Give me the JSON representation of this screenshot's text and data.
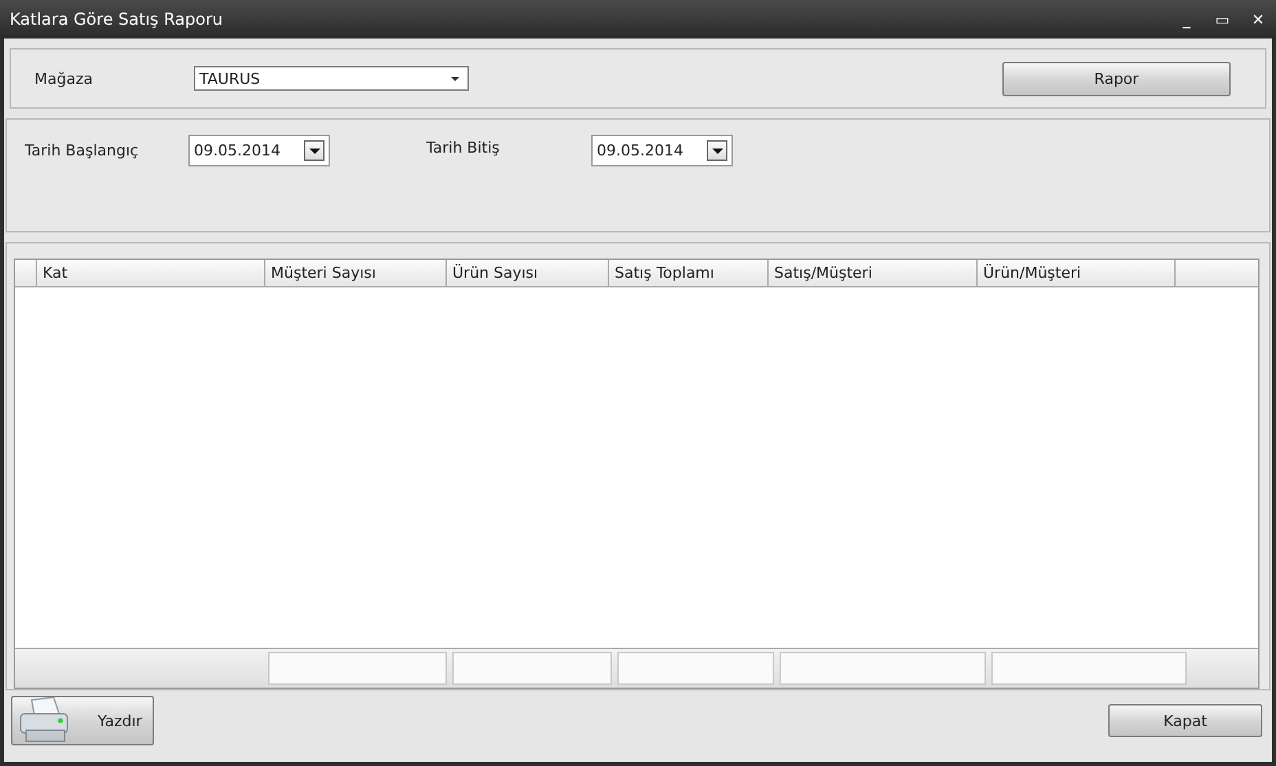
{
  "window": {
    "title": "Katlara Göre Satış Raporu",
    "controls": [
      "_",
      "▭",
      "✕"
    ]
  },
  "store": {
    "label": "Mağaza",
    "value": "TAURUS"
  },
  "report_button": "Rapor",
  "dates": [
    {
      "label": "Tarih Başlangıç",
      "value": "09.05.2014"
    },
    {
      "label": "Tarih Bitiş",
      "value": "09.05.2014"
    }
  ],
  "table": {
    "columns": [
      "Kat",
      "Müşteri Sayısı",
      "Ürün Sayısı",
      "Satış Toplamı",
      "Satış/Müşteri",
      "Ürün/Müşteri"
    ]
  },
  "print_button": "Yazdır",
  "close_button": "Kapat"
}
